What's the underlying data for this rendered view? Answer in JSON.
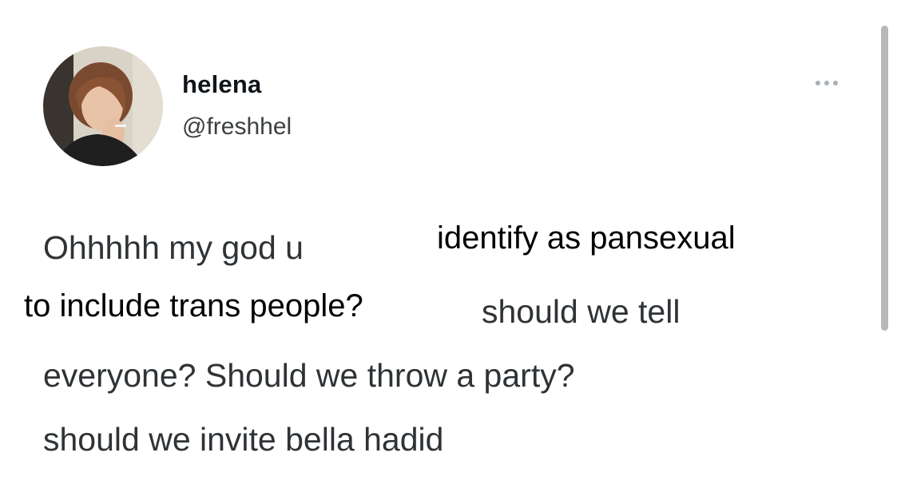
{
  "tweet": {
    "author": {
      "display_name": "helena",
      "handle": "@freshhel"
    },
    "more_icon": "ellipsis-icon",
    "text_lines": [
      "Ohhhhh my god u",
      "should we tell",
      "everyone? Should we throw a party?",
      "should we invite bella hadid"
    ]
  },
  "overlay": {
    "lines": [
      "identify as pansexual",
      "to include trans people?"
    ]
  },
  "colors": {
    "background": "#ffffff",
    "name": "#0f1419",
    "handle": "#3c4043",
    "tweet_text": "#2f3336",
    "overlay_text": "#000000",
    "scrollbar": "#b8b8b8"
  }
}
